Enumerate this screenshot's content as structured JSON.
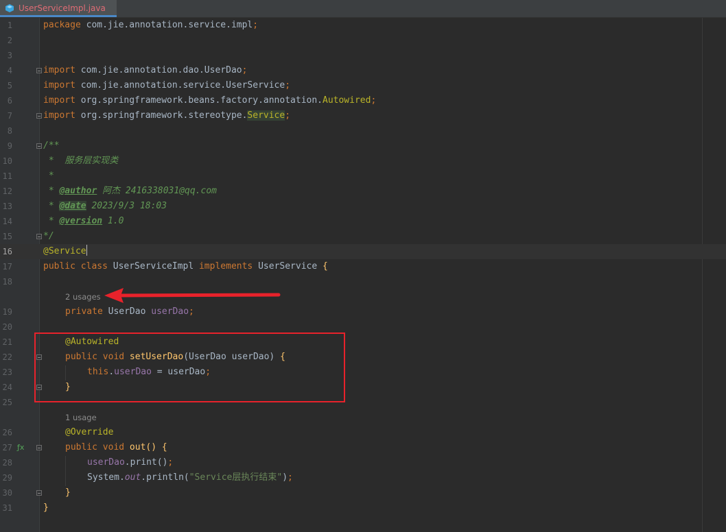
{
  "tab": {
    "title": "UserServiceImpl.java",
    "close": "×"
  },
  "code": {
    "l1": {
      "num": "1",
      "kw": "package",
      "rest": " com.jie.annotation.service.impl",
      "semi": ";"
    },
    "l2": {
      "num": "2"
    },
    "l3": {
      "num": "3"
    },
    "l4": {
      "num": "4",
      "kw": "import",
      "rest": " com.jie.annotation.dao.UserDao",
      "semi": ";"
    },
    "l5": {
      "num": "5",
      "kw": "import",
      "rest": " com.jie.annotation.service.UserService",
      "semi": ";"
    },
    "l6": {
      "num": "6",
      "kw": "import",
      "rest": " org.springframework.beans.factory.annotation.",
      "ann": "Autowired",
      "semi": ";"
    },
    "l7": {
      "num": "7",
      "kw": "import",
      "rest": " org.springframework.stereotype.",
      "cls": "Service",
      "semi": ";"
    },
    "l8": {
      "num": "8"
    },
    "l9": {
      "num": "9",
      "text": "/**"
    },
    "l10": {
      "num": "10",
      "text": " *  服务层实现类"
    },
    "l11": {
      "num": "11",
      "text": " *"
    },
    "l12": {
      "num": "12",
      "star": " * ",
      "tag": "@author",
      "val": " 阿杰 2416338031@qq.com"
    },
    "l13": {
      "num": "13",
      "star": " * ",
      "tag": "@date",
      "val": " 2023/9/3 18:03"
    },
    "l14": {
      "num": "14",
      "star": " * ",
      "tag": "@version",
      "val": " 1.0"
    },
    "l15": {
      "num": "15",
      "text": "*/"
    },
    "l16": {
      "num": "16",
      "ann": "@Service"
    },
    "l17": {
      "num": "17",
      "kw1": "public class",
      "name": " UserServiceImpl ",
      "kw2": "implements",
      "iface": " UserService ",
      "brace": "{"
    },
    "l18": {
      "num": "18"
    },
    "hint1": "2 usages",
    "l19": {
      "num": "19",
      "kw": "private",
      "type": " UserDao ",
      "field": "userDao",
      "semi": ";"
    },
    "l20": {
      "num": "20"
    },
    "l21": {
      "num": "21",
      "ann": "@Autowired"
    },
    "l22": {
      "num": "22",
      "kw": "public void ",
      "fn": "setUserDao",
      "params": "(UserDao userDao) ",
      "brace": "{"
    },
    "l23": {
      "num": "23",
      "kw": "this",
      "dot": ".",
      "field": "userDao",
      "rest": " = userDao",
      "semi": ";"
    },
    "l24": {
      "num": "24",
      "brace": "}"
    },
    "l25": {
      "num": "25"
    },
    "hint2": "1 usage",
    "l26": {
      "num": "26",
      "ann": "@Override"
    },
    "l27": {
      "num": "27",
      "kw": "public void ",
      "fn": "out",
      "params": "() ",
      "brace": "{"
    },
    "l28": {
      "num": "28",
      "field": "userDao",
      "rest": ".print()",
      "semi": ";"
    },
    "l29": {
      "num": "29",
      "cls": "System.",
      "field": "out",
      "rest": ".println(",
      "str": "\"Service层执行结束\"",
      "close": ")",
      "semi": ";"
    },
    "l30": {
      "num": "30",
      "brace": "}"
    },
    "l31": {
      "num": "31",
      "brace": "}"
    }
  },
  "gutter_icons": {
    "override": "ƒx"
  },
  "colors": {
    "keyword": "#cc7832",
    "annotation": "#bbb529",
    "field": "#9876aa",
    "doc": "#629755",
    "method": "#ffc66d",
    "highlight_box": "#e8222b"
  }
}
